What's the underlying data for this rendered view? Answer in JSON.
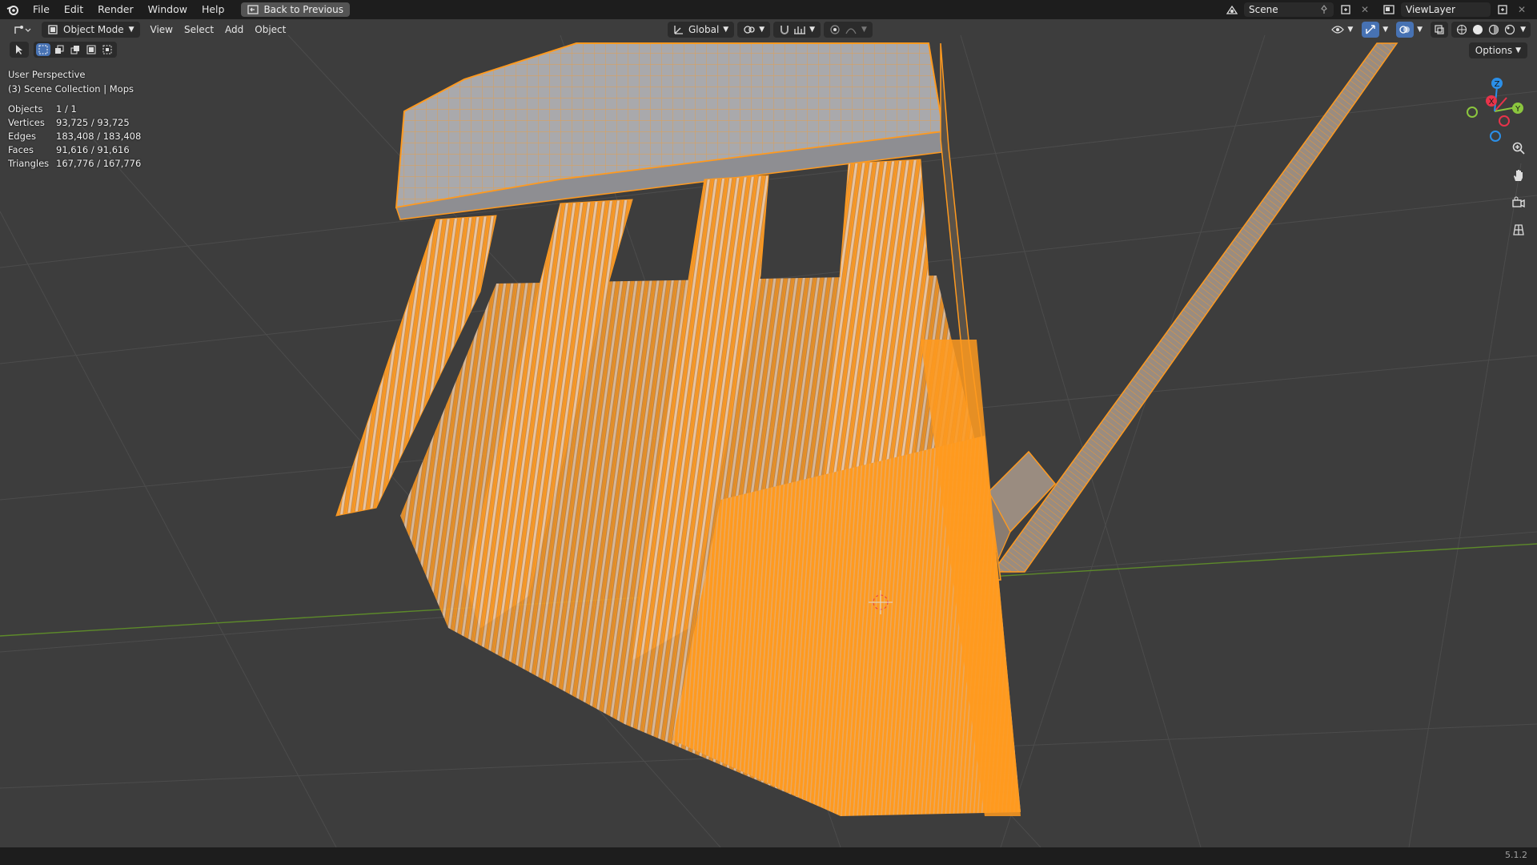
{
  "menu": {
    "items": [
      "File",
      "Edit",
      "Render",
      "Window",
      "Help"
    ],
    "back_button": "Back to Previous"
  },
  "topright": {
    "scene_name": "Scene",
    "view_layer": "ViewLayer"
  },
  "header": {
    "mode": "Object Mode",
    "menus": [
      "View",
      "Select",
      "Add",
      "Object"
    ],
    "transform_orientation": "Global",
    "options_label": "Options"
  },
  "overlay": {
    "perspective": "User Perspective",
    "collection": "(3) Scene Collection | Mops",
    "stats": [
      {
        "label": "Objects",
        "value": "1 / 1"
      },
      {
        "label": "Vertices",
        "value": "93,725 / 93,725"
      },
      {
        "label": "Edges",
        "value": "183,408 / 183,408"
      },
      {
        "label": "Faces",
        "value": "91,616 / 91,616"
      },
      {
        "label": "Triangles",
        "value": "167,776 / 167,776"
      }
    ]
  },
  "gizmo": {
    "x_label": "X",
    "y_label": "Y",
    "z_label": "Z",
    "x_color": "#e8334a",
    "y_color": "#8bc63e",
    "z_color": "#2b8fe8"
  },
  "colors": {
    "selection": "#ff9a1f",
    "background": "#3d3d3d"
  },
  "status": {
    "version": "5.1.2"
  }
}
